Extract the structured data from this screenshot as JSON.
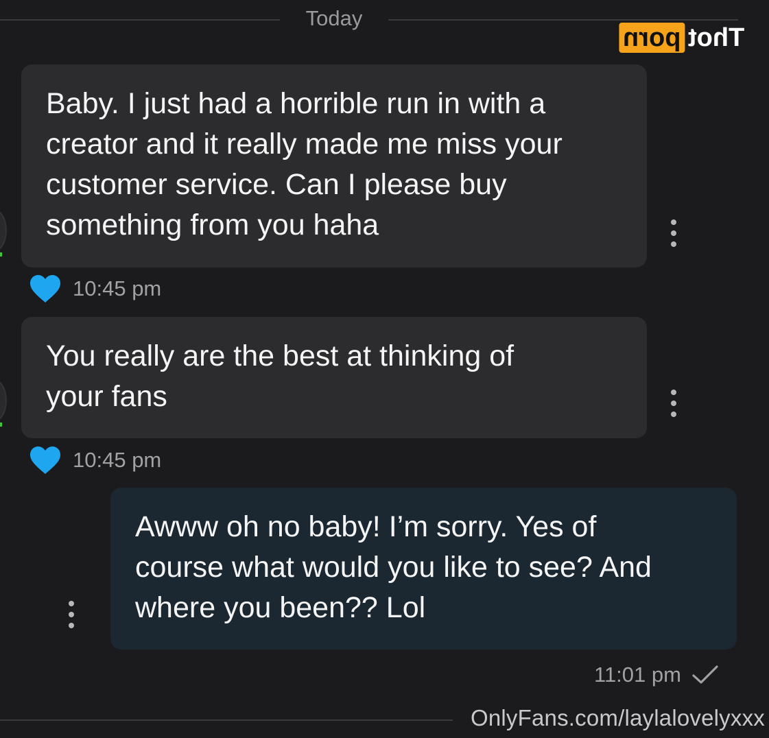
{
  "date_divider": {
    "label": "Today"
  },
  "logo": {
    "badge_text": "porn",
    "text": "Thot"
  },
  "messages": [
    {
      "direction": "incoming",
      "text": "Baby. I just had a horrible run in with a\ncreator and it really made me miss your\ncustomer service. Can I please buy\nsomething from you haha",
      "time": "10:45 pm",
      "liked": true
    },
    {
      "direction": "incoming",
      "text": "You really are the best at thinking of\nyour fans",
      "time": "10:45 pm",
      "liked": true
    },
    {
      "direction": "outgoing",
      "text": "Awww oh no baby! I’m sorry. Yes of\ncourse what would you like to see? And\nwhere you been?? Lol",
      "time": "11:01 pm",
      "read": true
    }
  ],
  "watermark": {
    "url": "OnlyFans.com/laylalovelyxxx"
  },
  "colors": {
    "background": "#1b1b1d",
    "incoming_bubble": "#2c2c2f",
    "outgoing_bubble": "#1b2832",
    "heart": "#1ea7f0",
    "logo_badge": "#f6a21a"
  }
}
